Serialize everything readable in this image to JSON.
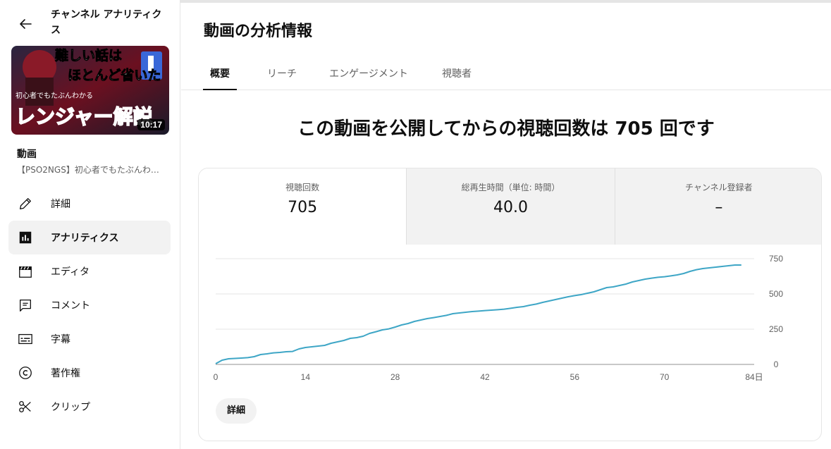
{
  "sidebar": {
    "channel_title": "チャンネル アナリティクス",
    "thumbnail": {
      "duration": "10:17",
      "overlay_line1": "難しい話は",
      "overlay_line2": "ほとんど省いた",
      "overlay_small": "初心者でもたぶんわかる",
      "overlay_main": "レンジャー解説"
    },
    "video_label": "動画",
    "video_title": "【PSO2NGS】初心者でもたぶんわかるレンジャー解説",
    "items": [
      {
        "label": "詳細",
        "icon": "pencil-icon"
      },
      {
        "label": "アナリティクス",
        "icon": "analytics-icon"
      },
      {
        "label": "エディタ",
        "icon": "clapperboard-icon"
      },
      {
        "label": "コメント",
        "icon": "comment-icon"
      },
      {
        "label": "字幕",
        "icon": "subtitles-icon"
      },
      {
        "label": "著作権",
        "icon": "copyright-icon"
      },
      {
        "label": "クリップ",
        "icon": "scissors-icon"
      }
    ],
    "active_item": "アナリティクス"
  },
  "main": {
    "title": "動画の分析情報",
    "tabs": [
      {
        "label": "概要"
      },
      {
        "label": "リーチ"
      },
      {
        "label": "エンゲージメント"
      },
      {
        "label": "視聴者"
      }
    ],
    "active_tab": "概要",
    "headline": "この動画を公開してからの視聴回数は 705 回です",
    "metrics": [
      {
        "label": "視聴回数",
        "value": "705"
      },
      {
        "label": "総再生時間（単位: 時間）",
        "value": "40.0"
      },
      {
        "label": "チャンネル登録者",
        "value": "–"
      }
    ],
    "details_button": "詳細"
  },
  "colors": {
    "line": "#3ea6c6",
    "grid": "#e5e5e5"
  },
  "chart_data": {
    "type": "line",
    "x": [
      0,
      1,
      2,
      4,
      5,
      6,
      7,
      8,
      9,
      10,
      11,
      12,
      13,
      14,
      15,
      16,
      17,
      18,
      19,
      20,
      21,
      22,
      23,
      24,
      25,
      26,
      27,
      28,
      29,
      30,
      31,
      32,
      33,
      34,
      35,
      36,
      37,
      38,
      39,
      40,
      41,
      42,
      43,
      44,
      45,
      46,
      47,
      48,
      49,
      50,
      51,
      52,
      53,
      54,
      55,
      56,
      57,
      58,
      59,
      60,
      61,
      62,
      63,
      64,
      65,
      66,
      67,
      68,
      69,
      70,
      71,
      72,
      73,
      74,
      75,
      76,
      77,
      78,
      79,
      80,
      81,
      82
    ],
    "values": [
      5,
      30,
      40,
      45,
      48,
      55,
      70,
      75,
      82,
      85,
      90,
      92,
      110,
      120,
      125,
      130,
      135,
      150,
      160,
      170,
      185,
      190,
      200,
      220,
      232,
      245,
      252,
      265,
      280,
      290,
      305,
      315,
      325,
      332,
      340,
      348,
      360,
      365,
      370,
      375,
      378,
      382,
      385,
      388,
      392,
      398,
      405,
      410,
      420,
      428,
      440,
      450,
      460,
      470,
      480,
      488,
      495,
      505,
      515,
      530,
      545,
      550,
      560,
      570,
      585,
      595,
      605,
      612,
      618,
      622,
      628,
      635,
      645,
      660,
      672,
      680,
      685,
      690,
      695,
      700,
      705,
      705
    ],
    "x_ticks": [
      "0",
      "14",
      "28",
      "42",
      "56",
      "70",
      "84日"
    ],
    "x_tick_values": [
      0,
      14,
      28,
      42,
      56,
      70,
      84
    ],
    "y_ticks": [
      "0",
      "250",
      "500",
      "750"
    ],
    "y_tick_values": [
      0,
      250,
      500,
      750
    ],
    "xlim": [
      0,
      84
    ],
    "ylim": [
      0,
      750
    ],
    "grid": true
  }
}
